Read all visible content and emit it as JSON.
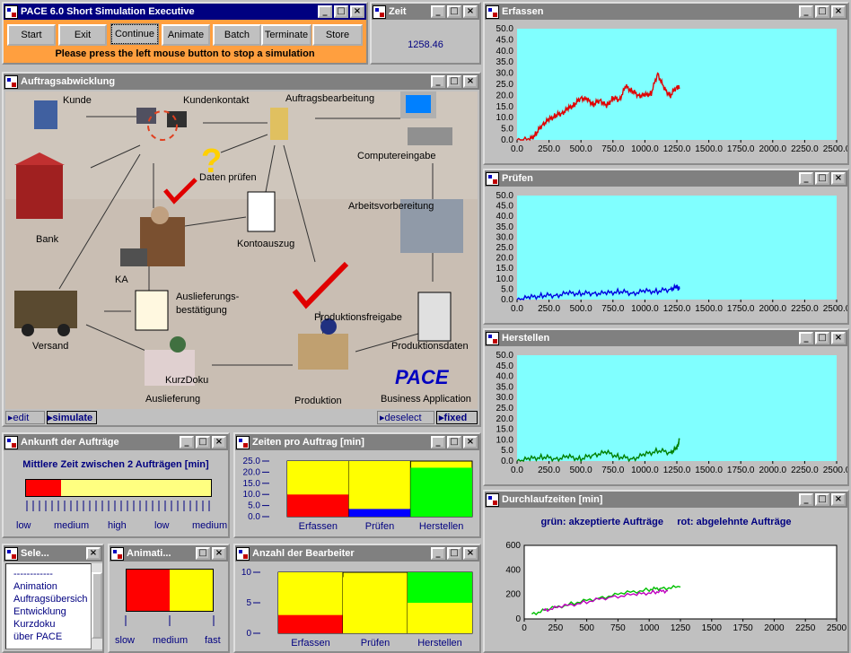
{
  "exec": {
    "title": "PACE 6.0  Short Simulation Executive",
    "buttons": [
      "Start",
      "Exit",
      "Continue",
      "Animate",
      "Batch",
      "Terminate",
      "Store"
    ],
    "message": "Please press the left mouse button to stop a simulation"
  },
  "zeit": {
    "title": "Zeit",
    "value": "1258.46"
  },
  "auftrag": {
    "title": "Auftragsabwicklung",
    "labels": {
      "kunde": "Kunde",
      "kundenkontakt": "Kundenkontakt",
      "auftragsbearbeitung": "Auftragsbearbeitung",
      "daten": "Daten prüfen",
      "computereingabe": "Computereingabe",
      "bank": "Bank",
      "kontoauszug": "Kontoauszug",
      "arbeitsvorbereitung": "Arbeitsvorbereitung",
      "ka": "KA",
      "auslieferungsbest": "Auslieferungs-\nbestätigung",
      "produktionsfreigabe": "Produktionsfreigabe",
      "versand": "Versand",
      "produktionsdaten": "Produktionsdaten",
      "kurzdoku": "KurzDoku",
      "auslieferung": "Auslieferung",
      "produktion": "Produktion",
      "logo": "PACE",
      "logo_sub": "Business Application"
    },
    "modes": {
      "edit": "edit",
      "simulate": "simulate",
      "deselect": "deselect",
      "fixed": "fixed"
    }
  },
  "ankunft": {
    "title": "Ankunft der Aufträge",
    "subtitle": "Mittlere Zeit zwischen 2 Aufträgen [min]",
    "level": 0.19,
    "scale": [
      "low",
      "medium",
      "high",
      "low",
      "medium"
    ]
  },
  "zeiten": {
    "title": "Zeiten pro Auftrag [min]"
  },
  "selekt": {
    "title": "Sele...",
    "items": [
      "------------",
      "Animation",
      "Auftragsübersich",
      "Entwicklung",
      "Kurzdoku",
      "über PACE"
    ]
  },
  "animation": {
    "title": "Animati...",
    "level": 0.5,
    "scale": [
      "slow",
      "medium",
      "fast"
    ]
  },
  "anzahl": {
    "title": "Anzahl der Bearbeiter"
  },
  "durchlauf": {
    "title": "Durchlaufzeiten [min]",
    "legend": "grün: akzeptierte Aufträge     rot: abgelehnte Aufträge"
  },
  "colors": {
    "red": "#ff0000",
    "yellow": "#ffff00",
    "green": "#00ff00",
    "blue": "#0000ff",
    "cyan": "#80ffff",
    "navy": "#000080"
  },
  "chart_data": [
    {
      "type": "line",
      "title": "Erfassen",
      "xlim": [
        0,
        2500
      ],
      "ylim": [
        0,
        50
      ],
      "x_ticks": [
        "0.0",
        "250.0",
        "500.0",
        "750.0",
        "1000.0",
        "1250.0",
        "1500.0",
        "1750.0",
        "2000.0",
        "2250.0",
        "2500.0"
      ],
      "y_ticks": [
        "50.0",
        "45.0",
        "40.0",
        "35.0",
        "30.0",
        "25.0",
        "20.0",
        "15.0",
        "10.0",
        "5.0",
        "0.0"
      ],
      "color": "#e00000",
      "points": [
        [
          0,
          0
        ],
        [
          100,
          0
        ],
        [
          150,
          3
        ],
        [
          200,
          7
        ],
        [
          250,
          9
        ],
        [
          300,
          11
        ],
        [
          350,
          12
        ],
        [
          400,
          14
        ],
        [
          450,
          16
        ],
        [
          500,
          19
        ],
        [
          550,
          18
        ],
        [
          600,
          16
        ],
        [
          650,
          18
        ],
        [
          700,
          15
        ],
        [
          750,
          19
        ],
        [
          800,
          18
        ],
        [
          850,
          24
        ],
        [
          900,
          22
        ],
        [
          950,
          20
        ],
        [
          1000,
          20
        ],
        [
          1050,
          21
        ],
        [
          1100,
          30
        ],
        [
          1150,
          23
        ],
        [
          1200,
          20
        ],
        [
          1250,
          24
        ],
        [
          1270,
          23
        ]
      ]
    },
    {
      "type": "line",
      "title": "Prüfen",
      "xlim": [
        0,
        2500
      ],
      "ylim": [
        0,
        50
      ],
      "x_ticks": [
        "0.0",
        "250.0",
        "500.0",
        "750.0",
        "1000.0",
        "1250.0",
        "1500.0",
        "1750.0",
        "2000.0",
        "2250.0",
        "2500.0"
      ],
      "y_ticks": [
        "50.0",
        "45.0",
        "40.0",
        "35.0",
        "30.0",
        "25.0",
        "20.0",
        "15.0",
        "10.0",
        "5.0",
        "0.0"
      ],
      "color": "#0000e0",
      "points": [
        [
          0,
          0
        ],
        [
          100,
          1
        ],
        [
          200,
          2
        ],
        [
          300,
          2
        ],
        [
          400,
          3
        ],
        [
          500,
          3
        ],
        [
          600,
          3
        ],
        [
          700,
          3
        ],
        [
          800,
          4
        ],
        [
          900,
          3
        ],
        [
          1000,
          4
        ],
        [
          1100,
          4
        ],
        [
          1200,
          5
        ],
        [
          1250,
          6
        ],
        [
          1270,
          5
        ]
      ]
    },
    {
      "type": "line",
      "title": "Herstellen",
      "xlim": [
        0,
        2500
      ],
      "ylim": [
        0,
        50
      ],
      "x_ticks": [
        "0.0",
        "250.0",
        "500.0",
        "750.0",
        "1000.0",
        "1250.0",
        "1500.0",
        "1750.0",
        "2000.0",
        "2250.0",
        "2500.0"
      ],
      "y_ticks": [
        "50.0",
        "45.0",
        "40.0",
        "35.0",
        "30.0",
        "25.0",
        "20.0",
        "15.0",
        "10.0",
        "5.0",
        "0.0"
      ],
      "color": "#008000",
      "points": [
        [
          0,
          0
        ],
        [
          100,
          1
        ],
        [
          200,
          2
        ],
        [
          300,
          1
        ],
        [
          400,
          2
        ],
        [
          500,
          1
        ],
        [
          600,
          3
        ],
        [
          700,
          4
        ],
        [
          800,
          2
        ],
        [
          900,
          1
        ],
        [
          1000,
          3
        ],
        [
          1100,
          5
        ],
        [
          1200,
          4
        ],
        [
          1250,
          6
        ],
        [
          1270,
          10
        ]
      ]
    },
    {
      "type": "bar",
      "title": "Zeiten pro Auftrag [min]",
      "categories": [
        "Erfassen",
        "Prüfen",
        "Herstellen"
      ],
      "y_ticks": [
        "25.0",
        "20.0",
        "15.0",
        "10.0",
        "5.0",
        "0.0"
      ],
      "ylim": [
        0,
        25
      ],
      "series": [
        {
          "values": [
            10,
            3.5,
            0
          ]
        },
        {
          "values": [
            15,
            21.5,
            0
          ]
        },
        {
          "values": [
            0,
            0,
            22
          ]
        }
      ]
    },
    {
      "type": "bar",
      "title": "Anzahl der Bearbeiter",
      "categories": [
        "Erfassen",
        "Prüfen",
        "Herstellen"
      ],
      "y_ticks": [
        "10",
        "5",
        "0"
      ],
      "ylim": [
        0,
        10
      ],
      "series": [
        {
          "values": [
            3,
            0.8,
            0
          ]
        },
        {
          "values": [
            7,
            9.2,
            5
          ]
        },
        {
          "values": [
            0,
            0,
            5
          ]
        }
      ]
    },
    {
      "type": "line",
      "title": "Durchlaufzeiten [min]",
      "xlim": [
        0,
        2500
      ],
      "ylim": [
        0,
        600
      ],
      "x_ticks": [
        "0",
        "250",
        "500",
        "750",
        "1000",
        "1250",
        "1500",
        "1750",
        "2000",
        "2250",
        "2500"
      ],
      "y_ticks": [
        "600",
        "400",
        "200",
        "0"
      ],
      "series": [
        {
          "color": "#00c000",
          "points": [
            [
              60,
              40
            ],
            [
              200,
              80
            ],
            [
              400,
              130
            ],
            [
              600,
              170
            ],
            [
              800,
              210
            ],
            [
              1000,
              240
            ],
            [
              1100,
              250
            ],
            [
              1250,
              260
            ]
          ]
        },
        {
          "color": "#c000c0",
          "points": [
            [
              150,
              70
            ],
            [
              300,
              100
            ],
            [
              500,
              140
            ],
            [
              700,
              180
            ],
            [
              900,
              200
            ],
            [
              1050,
              220
            ],
            [
              1150,
              230
            ]
          ]
        }
      ]
    }
  ]
}
